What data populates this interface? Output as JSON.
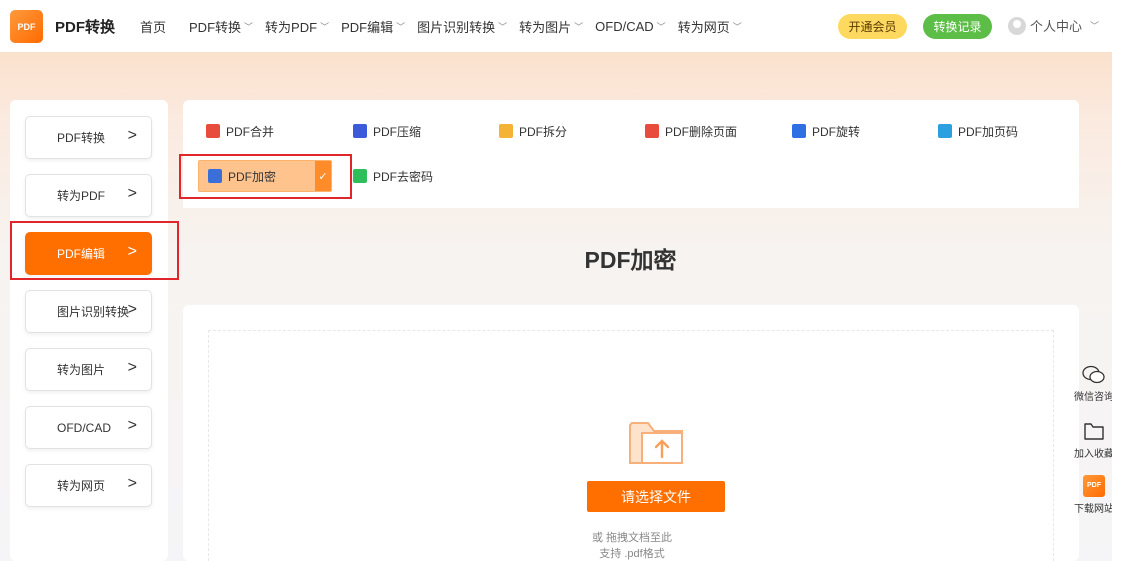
{
  "header": {
    "logo_text": "PDF",
    "brand": "PDF转换",
    "nav": [
      {
        "label": "首页",
        "dropdown": false
      },
      {
        "label": "PDF转换",
        "dropdown": true
      },
      {
        "label": "转为PDF",
        "dropdown": true
      },
      {
        "label": "PDF编辑",
        "dropdown": true
      },
      {
        "label": "图片识别转换",
        "dropdown": true
      },
      {
        "label": "转为图片",
        "dropdown": true
      },
      {
        "label": "OFD/CAD",
        "dropdown": true
      },
      {
        "label": "转为网页",
        "dropdown": true
      }
    ],
    "vip_label": "开通会员",
    "record_label": "转换记录",
    "user_label": "个人中心"
  },
  "sidebar": {
    "items": [
      {
        "label": "PDF转换"
      },
      {
        "label": "转为PDF"
      },
      {
        "label": "PDF编辑",
        "active": true
      },
      {
        "label": "图片识别转换"
      },
      {
        "label": "转为图片"
      },
      {
        "label": "OFD/CAD"
      },
      {
        "label": "转为网页"
      }
    ]
  },
  "tools": [
    {
      "label": "PDF合并",
      "icon": "merge-icon",
      "color": "#e84c3d"
    },
    {
      "label": "PDF压缩",
      "icon": "compress-icon",
      "color": "#3b5bdb"
    },
    {
      "label": "PDF拆分",
      "icon": "split-icon",
      "color": "#f5b335"
    },
    {
      "label": "PDF删除页面",
      "icon": "delete-page-icon",
      "color": "#e84c3d"
    },
    {
      "label": "PDF旋转",
      "icon": "rotate-icon",
      "color": "#2f6fe4"
    },
    {
      "label": "PDF加页码",
      "icon": "page-number-icon",
      "color": "#2aa0e0"
    },
    {
      "label": "PDF加密",
      "icon": "lock-icon",
      "color": "#3b6fd8",
      "selected": true
    },
    {
      "label": "PDF去密码",
      "icon": "unlock-icon",
      "color": "#2fbf5a"
    }
  ],
  "main": {
    "title": "PDF加密",
    "choose_button": "请选择文件",
    "hint_drag": "或 拖拽文档至此",
    "hint_format": "支持 .pdf格式"
  },
  "float": {
    "wechat": "微信咨询",
    "favorite": "加入收藏",
    "download": "下载网站",
    "download_logo": "PDF"
  },
  "colors": {
    "accent": "#ff6f00",
    "vip": "#fed95f",
    "record": "#5cbe46",
    "highlight_box": "#e0262a"
  }
}
